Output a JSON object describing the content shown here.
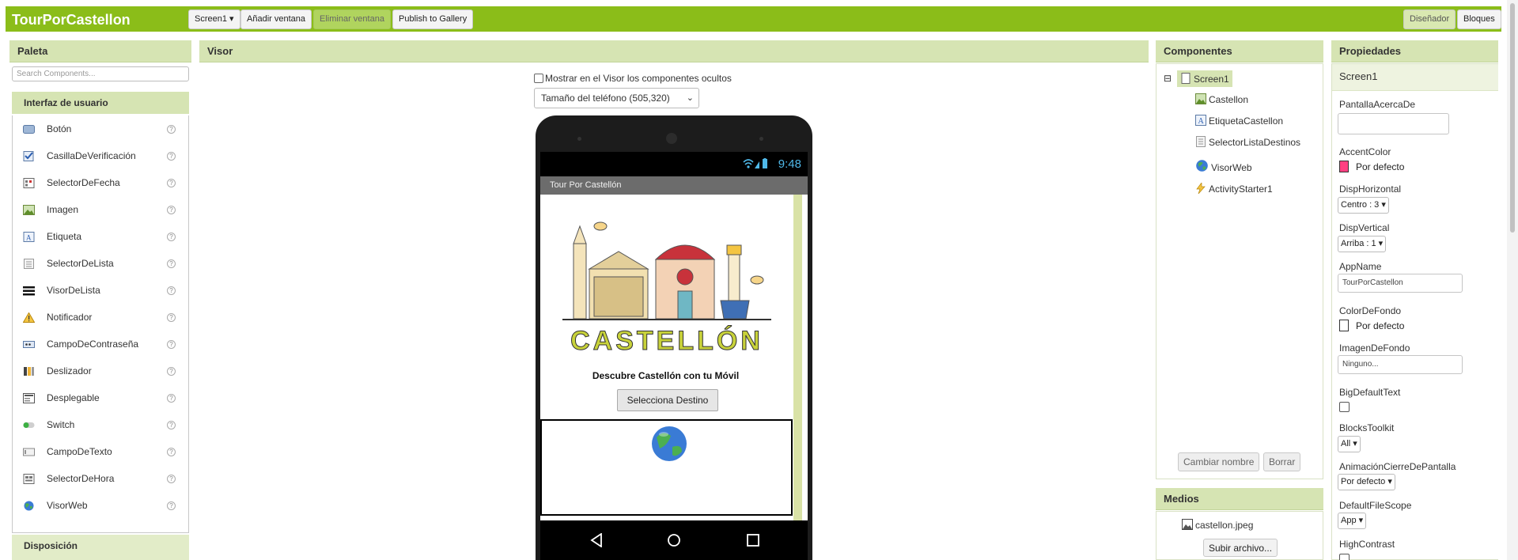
{
  "app": {
    "title": "TourPorCastellon",
    "colors": {
      "brand": "#8bbd19",
      "panel_header": "#d6e4b3",
      "accent_swatch": "#ff4081"
    }
  },
  "toolbar": {
    "screen_dropdown": "Screen1 ▾",
    "add_screen": "Añadir ventana",
    "remove_screen": "Eliminar ventana",
    "publish": "Publish to Gallery",
    "designer": "Diseñador",
    "blocks": "Bloques"
  },
  "palette": {
    "title": "Paleta",
    "search_placeholder": "Search Components...",
    "category_ui": "Interfaz de usuario",
    "category_layout": "Disposición",
    "help_glyph": "?",
    "items": [
      {
        "label": "Botón",
        "icon": "button-icon"
      },
      {
        "label": "CasillaDeVerificación",
        "icon": "checkbox-icon"
      },
      {
        "label": "SelectorDeFecha",
        "icon": "calendar-icon"
      },
      {
        "label": "Imagen",
        "icon": "image-icon"
      },
      {
        "label": "Etiqueta",
        "icon": "label-icon"
      },
      {
        "label": "SelectorDeLista",
        "icon": "list-picker-icon"
      },
      {
        "label": "VisorDeLista",
        "icon": "list-view-icon"
      },
      {
        "label": "Notificador",
        "icon": "warning-icon"
      },
      {
        "label": "CampoDeContraseña",
        "icon": "password-icon"
      },
      {
        "label": "Deslizador",
        "icon": "slider-icon"
      },
      {
        "label": "Desplegable",
        "icon": "spinner-icon"
      },
      {
        "label": "Switch",
        "icon": "switch-icon"
      },
      {
        "label": "CampoDeTexto",
        "icon": "textbox-icon"
      },
      {
        "label": "SelectorDeHora",
        "icon": "clock-icon"
      },
      {
        "label": "VisorWeb",
        "icon": "globe-icon"
      }
    ]
  },
  "viewer": {
    "title": "Visor",
    "show_hidden": "Mostrar en el Visor los componentes ocultos",
    "phone_size": "Tamaño del teléfono (505,320)",
    "time": "9:48",
    "app_bar_title": "Tour Por Castellón",
    "logo_text": "CASTELLÓN",
    "subtitle": "Descubre Castellón con tu Móvil",
    "button_label": "Selecciona Destino"
  },
  "components": {
    "title": "Componentes",
    "tree_toggle": "⊟",
    "root": "Screen1",
    "children": [
      "Castellon",
      "EtiquetaCastellon",
      "SelectorListaDestinos",
      "VisorWeb",
      "ActivityStarter1"
    ],
    "rename_button": "Cambiar nombre",
    "delete_button": "Borrar"
  },
  "media": {
    "title": "Medios",
    "files": [
      "castellon.jpeg"
    ],
    "upload_button": "Subir archivo..."
  },
  "properties": {
    "title": "Propiedades",
    "component": "Screen1",
    "about_label": "PantallaAcercaDe",
    "accent_label": "AccentColor",
    "accent_value": "Por defecto",
    "align_h_label": "DispHorizontal",
    "align_h_value": "Centro : 3 ▾",
    "align_v_label": "DispVertical",
    "align_v_value": "Arriba : 1 ▾",
    "appname_label": "AppName",
    "appname_value": "TourPorCastellon",
    "bgcolor_label": "ColorDeFondo",
    "bgcolor_value": "Por defecto",
    "bgimage_label": "ImagenDeFondo",
    "bgimage_value": "Ninguno...",
    "bigtext_label": "BigDefaultText",
    "toolkit_label": "BlocksToolkit",
    "toolkit_value": "All ▾",
    "close_anim_label": "AnimaciónCierreDePantalla",
    "close_anim_value": "Por defecto ▾",
    "filescope_label": "DefaultFileScope",
    "filescope_value": "App ▾",
    "highcontrast_label": "HighContrast"
  }
}
